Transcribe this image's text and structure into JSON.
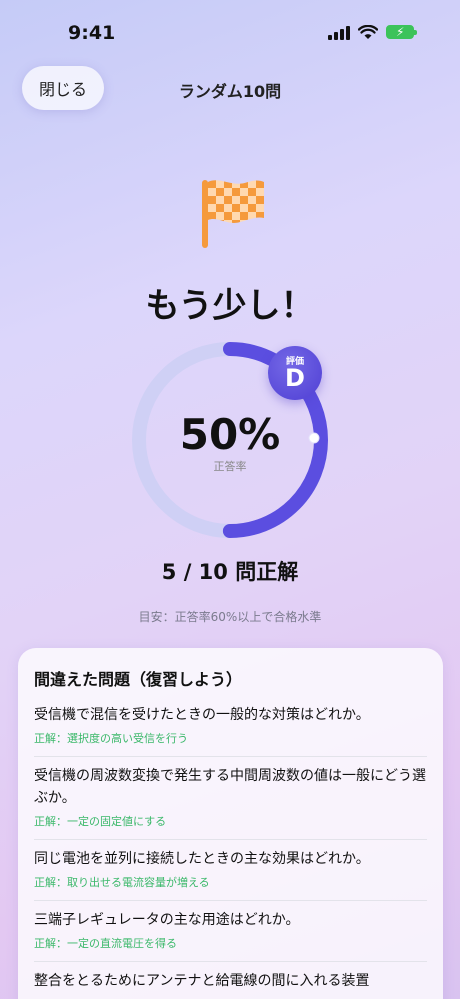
{
  "status": {
    "time": "9:41"
  },
  "nav": {
    "close_label": "閉じる",
    "title": "ランダム10問"
  },
  "result": {
    "headline": "もう少し！",
    "percent_text": "50%",
    "percent_label": "正答率",
    "progress_fraction": 0.5,
    "grade_caption": "評価",
    "grade": "D",
    "score_text": "5 / 10 問正解",
    "hint": "目安：正答率60%以上で合格水準"
  },
  "review": {
    "title": "間違えた問題（復習しよう）",
    "items": [
      {
        "question": "受信機で混信を受けたときの一般的な対策はどれか。",
        "answer": "正解：選択度の高い受信を行う"
      },
      {
        "question": "受信機の周波数変換で発生する中間周波数の値は一般にどう選ぶか。",
        "answer": "正解：一定の固定値にする"
      },
      {
        "question": "同じ電池を並列に接続したときの主な効果はどれか。",
        "answer": "正解：取り出せる電流容量が増える"
      },
      {
        "question": "三端子レギュレータの主な用途はどれか。",
        "answer": "正解：一定の直流電圧を得る"
      },
      {
        "question": "整合をとるためにアンテナと給電線の間に入れる装置",
        "answer": ""
      }
    ]
  },
  "colors": {
    "ring_track": "#cfd0f5",
    "ring_progress": "#5b4ee0",
    "answer_green": "#3bb86a",
    "flag_orange": "#f59a3c"
  }
}
